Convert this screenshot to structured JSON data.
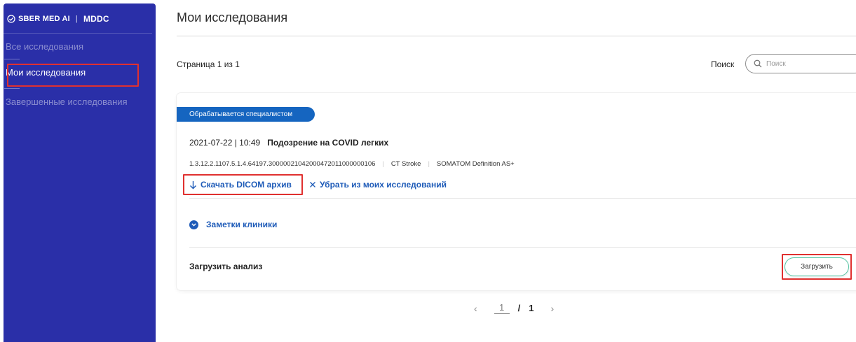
{
  "sidebar": {
    "brand_name": "SBER MED AI",
    "brand_separator": "|",
    "product": "MDDC",
    "items": [
      {
        "label": "Все исследования"
      },
      {
        "label": "Мои исследования"
      },
      {
        "label": "Завершенные исследования"
      }
    ],
    "active_index": 1
  },
  "main": {
    "title": "Мои исследования",
    "page_info": "Страница 1 из 1",
    "search": {
      "label": "Поиск",
      "placeholder": "Поиск",
      "value": ""
    }
  },
  "study": {
    "status": "Обрабатывается специалистом",
    "date": "2021-07-22 | 10:49",
    "title": "Подозрение на COVID легких",
    "uid": "1.3.12.2.1107.5.1.4.64197.30000021042000472011000000106",
    "modality": "CT Stroke",
    "device": "SOMATOM Definition AS+",
    "download_label": "Скачать DICOM архив",
    "remove_label": "Убрать из моих исследований",
    "notes_label": "Заметки клиники",
    "upload_label": "Загрузить анализ",
    "upload_button": "Загрузить"
  },
  "pagination": {
    "current": "1",
    "separator": "/",
    "total": "1"
  },
  "colors": {
    "sidebar_bg": "#2a2fa8",
    "accent": "#1e5bb8",
    "badge_bg": "#1565c0",
    "upload_border": "#56c6a4",
    "highlight": "#e0302f"
  }
}
